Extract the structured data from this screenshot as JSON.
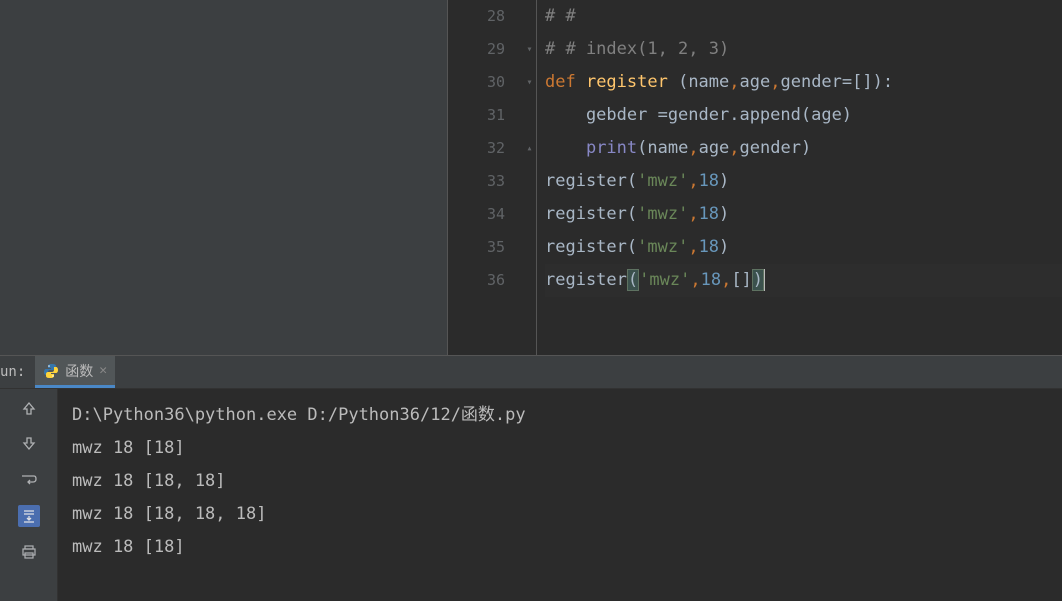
{
  "editor": {
    "lines": [
      {
        "num": 28,
        "fold": "",
        "tokens": [
          {
            "t": "# #",
            "c": "comment"
          }
        ]
      },
      {
        "num": 29,
        "fold": "▾",
        "tokens": [
          {
            "t": "# # index(1, 2, 3)",
            "c": "comment"
          }
        ]
      },
      {
        "num": 30,
        "fold": "▾",
        "tokens": [
          {
            "t": "def ",
            "c": "kw"
          },
          {
            "t": "register",
            "c": "fn"
          },
          {
            "t": " (name",
            "c": "param"
          },
          {
            "t": ",",
            "c": "kw"
          },
          {
            "t": "age",
            "c": "param"
          },
          {
            "t": ",",
            "c": "kw"
          },
          {
            "t": "gender=[]):",
            "c": "param"
          }
        ]
      },
      {
        "num": 31,
        "fold": "",
        "tokens": [
          {
            "t": "    gebder =gender.append(age)",
            "c": "param"
          }
        ]
      },
      {
        "num": 32,
        "fold": "▴",
        "tokens": [
          {
            "t": "    ",
            "c": "param"
          },
          {
            "t": "print",
            "c": "builtin"
          },
          {
            "t": "(name",
            "c": "param"
          },
          {
            "t": ",",
            "c": "kw"
          },
          {
            "t": "age",
            "c": "param"
          },
          {
            "t": ",",
            "c": "kw"
          },
          {
            "t": "gender)",
            "c": "param"
          }
        ]
      },
      {
        "num": 33,
        "fold": "",
        "tokens": [
          {
            "t": "register(",
            "c": "param"
          },
          {
            "t": "'mwz'",
            "c": "str"
          },
          {
            "t": ",",
            "c": "kw"
          },
          {
            "t": "18",
            "c": "num"
          },
          {
            "t": ")",
            "c": "param"
          }
        ]
      },
      {
        "num": 34,
        "fold": "",
        "tokens": [
          {
            "t": "register(",
            "c": "param"
          },
          {
            "t": "'mwz'",
            "c": "str"
          },
          {
            "t": ",",
            "c": "kw"
          },
          {
            "t": "18",
            "c": "num"
          },
          {
            "t": ")",
            "c": "param"
          }
        ]
      },
      {
        "num": 35,
        "fold": "",
        "tokens": [
          {
            "t": "register(",
            "c": "param"
          },
          {
            "t": "'mwz'",
            "c": "str"
          },
          {
            "t": ",",
            "c": "kw"
          },
          {
            "t": "18",
            "c": "num"
          },
          {
            "t": ")",
            "c": "param"
          }
        ]
      },
      {
        "num": 36,
        "fold": "",
        "current": true,
        "tokens": [
          {
            "t": "register",
            "c": "param"
          },
          {
            "t": "(",
            "c": "param",
            "hl": true
          },
          {
            "t": "'mwz'",
            "c": "str"
          },
          {
            "t": ",",
            "c": "kw"
          },
          {
            "t": "18",
            "c": "num"
          },
          {
            "t": ",",
            "c": "kw"
          },
          {
            "t": "[]",
            "c": "param"
          },
          {
            "t": ")",
            "c": "param",
            "hl": true
          }
        ]
      }
    ]
  },
  "run": {
    "label": "un:",
    "tab": {
      "name": "函数"
    },
    "console_lines": [
      "D:\\Python36\\python.exe D:/Python36/12/函数.py",
      "mwz 18 [18]",
      "mwz 18 [18, 18]",
      "mwz 18 [18, 18, 18]",
      "mwz 18 [18]"
    ],
    "tools": [
      "arrow-up",
      "arrow-down",
      "wrap",
      "scroll-to-end",
      "print"
    ]
  }
}
